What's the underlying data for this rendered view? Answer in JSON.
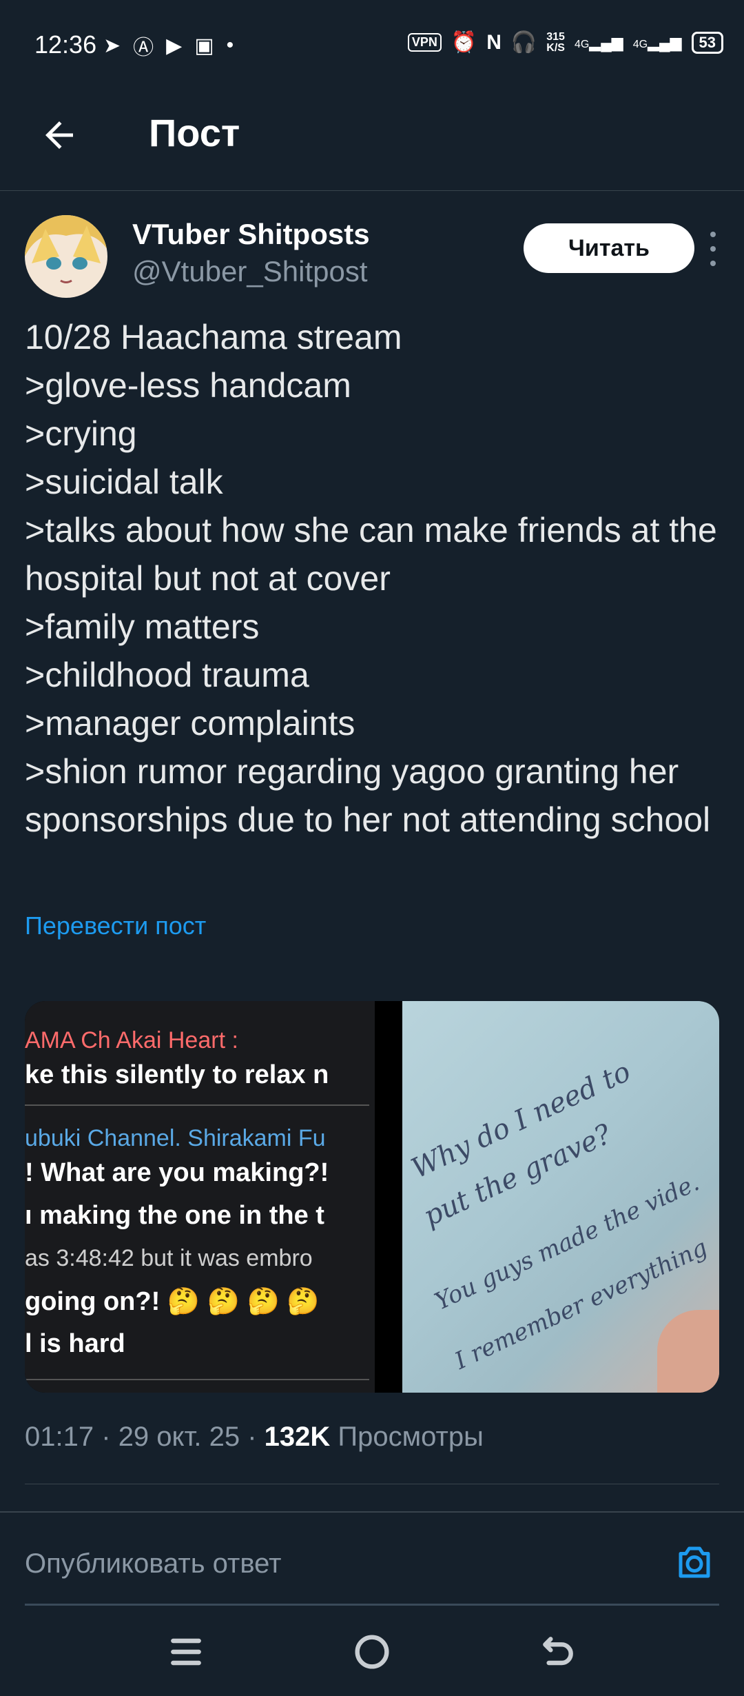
{
  "status_bar": {
    "time": "12:36",
    "vpn": "VPN",
    "speed_value": "315",
    "speed_unit": "K/S",
    "net1": "4G",
    "net2": "4G",
    "battery": "53"
  },
  "header": {
    "title": "Пост"
  },
  "author": {
    "name": "VTuber Shitposts",
    "handle": "@Vtuber_Shitpost",
    "follow_label": "Читать"
  },
  "tweet": {
    "text": "10/28 Haachama stream\n>glove-less handcam\n>crying\n>suicidal talk\n>talks about how she can make friends at the hospital but not at cover\n>family matters\n>childhood trauma\n>manager complaints\n>shion rumor regarding yagoo granting her sponsorships due to her not attending school",
    "translate_label": "Перевести пост"
  },
  "media": {
    "chat_lines": [
      "AMA Ch Akai Heart :",
      "ke this silently to relax n",
      "ubuki Channel. Shirakami Fu",
      "! What are you making?!",
      "ı making the one in the t",
      "as 3:48:42 but it was embro",
      " going on?! 🤔 🤔 🤔 🤔",
      "l is hard"
    ],
    "note_lines": [
      "Why do I need to",
      "put the grave?",
      "You guys made the vide.",
      "I remember everything"
    ]
  },
  "meta": {
    "time": "01:17",
    "date": "29 окт. 25",
    "views_count": "132K",
    "views_label": "Просмотры",
    "sep": "·"
  },
  "reply": {
    "placeholder": "Опубликовать ответ"
  },
  "colors": {
    "background": "#15202b",
    "accent": "#1d9bf0",
    "muted": "#8b98a5"
  }
}
